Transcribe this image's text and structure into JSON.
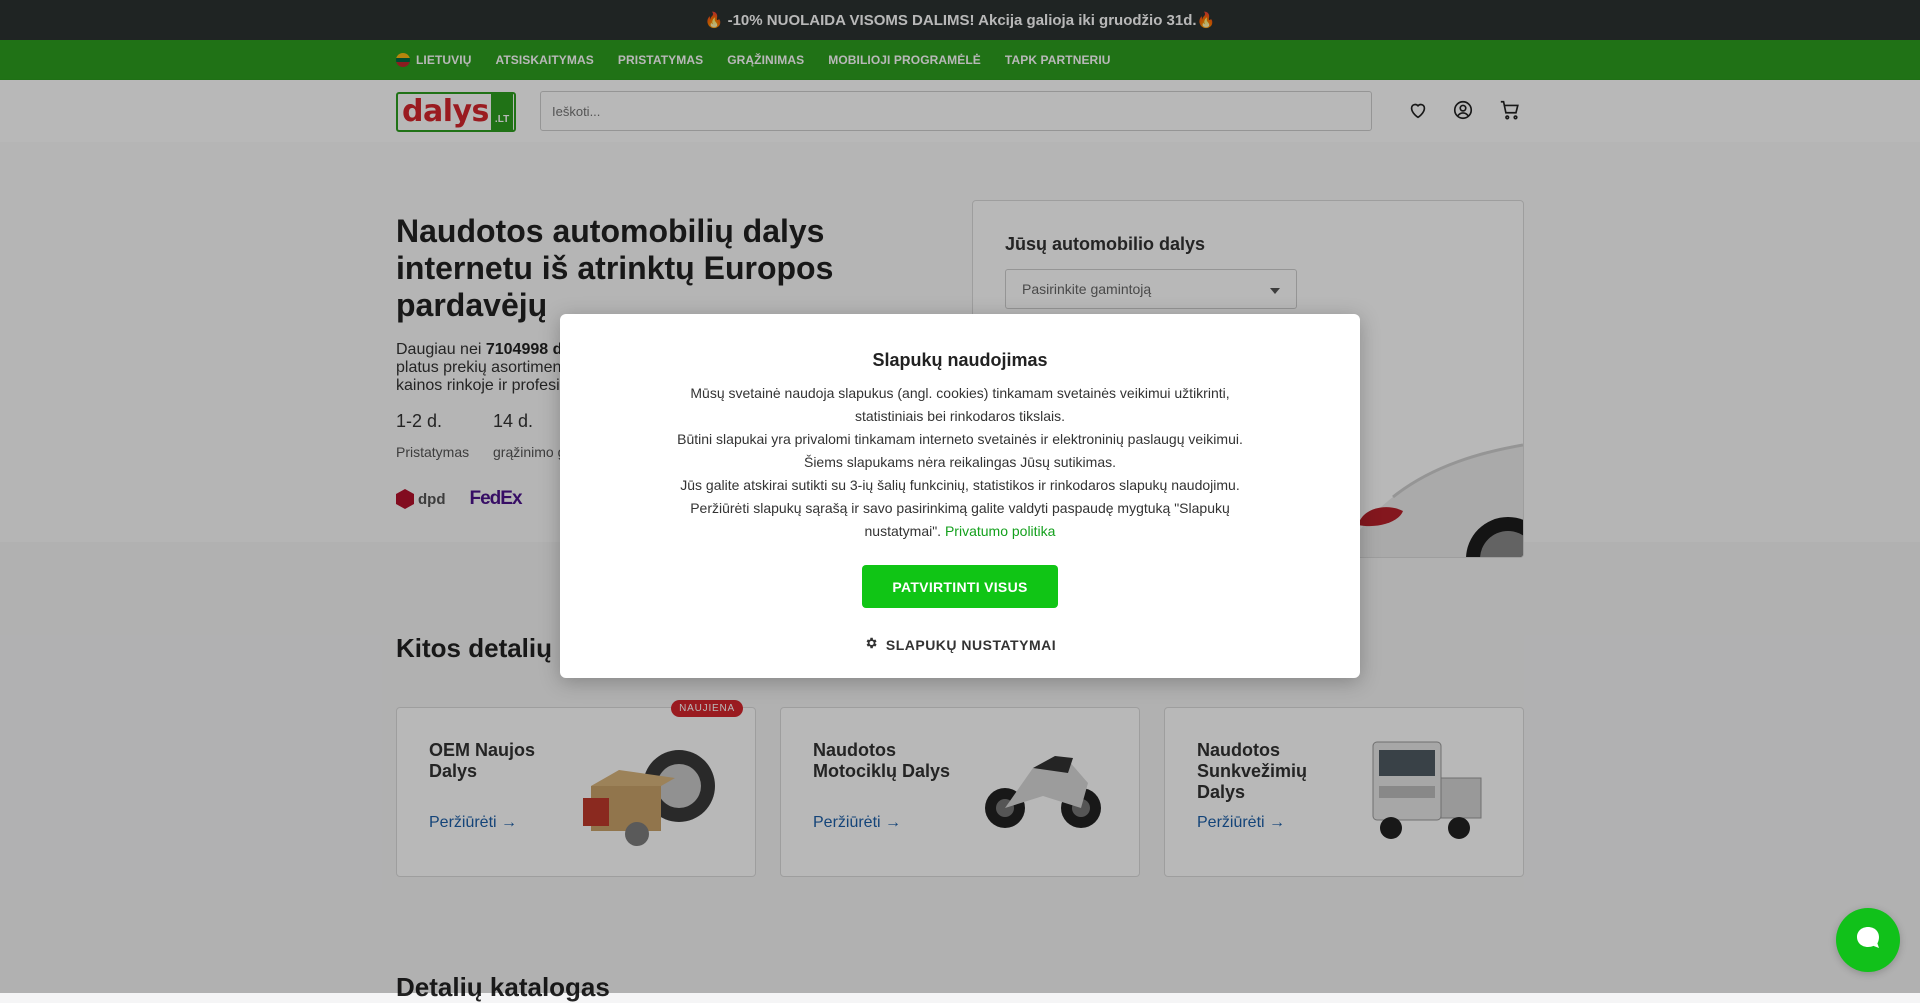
{
  "promo": {
    "text": "🔥 -10% NUOLAIDA VISOMS DALIMS! Akcija galioja iki gruodžio 31d.🔥"
  },
  "nav": {
    "language": "LIETUVIŲ",
    "items": [
      "ATSISKAITYMAS",
      "PRISTATYMAS",
      "GRĄŽINIMAS",
      "MOBILIOJI PROGRAMĖLĖ",
      "TAPK PARTNERIU"
    ]
  },
  "header": {
    "logo_text": "dalys",
    "logo_tld": ".LT",
    "search_placeholder": "Ieškoti..."
  },
  "hero": {
    "title": "Naudotos automobilių dalys internetu iš atrinktų Europos pardavėjų",
    "desc_prefix": "Daugiau nei ",
    "desc_bold": "7104998 d",
    "desc_line2": "platus prekių asortimen",
    "desc_line3": "kainos rinkoje ir profesi",
    "stats": [
      {
        "value": "1-2 d.",
        "label": "Pristatymas"
      },
      {
        "value": "14 d.",
        "label": "grąžinimo g"
      }
    ],
    "carriers": [
      "dpd",
      "FedEx"
    ]
  },
  "parts_panel": {
    "title": "Jūsų automobilio dalys",
    "maker_placeholder": "Pasirinkite gamintoją"
  },
  "categories": {
    "title": "Kitos detalių",
    "view_label": "Peržiūrėti",
    "badge": "NAUJIENA",
    "items": [
      {
        "name": "OEM Naujos Dalys"
      },
      {
        "name": "Naudotos Motociklų Dalys"
      },
      {
        "name": "Naudotos Sunkvežimių Dalys"
      }
    ]
  },
  "catalog": {
    "title": "Detalių katalogas"
  },
  "cookie": {
    "title": "Slapukų naudojimas",
    "p1": "Mūsų svetainė naudoja slapukus (angl. cookies) tinkamam svetainės veikimui užtikrinti, statistiniais bei rinkodaros tikslais.",
    "p2": "Būtini slapukai yra privalomi tinkamam interneto svetainės ir elektroninių paslaugų veikimui. Šiems slapukams nėra reikalingas Jūsų sutikimas.",
    "p3": "Jūs galite atskirai sutikti su 3-ių šalių funkcinių, statistikos ir rinkodaros slapukų naudojimu. Peržiūrėti slapukų sąrašą ir savo pasirinkimą galite valdyti paspaudę mygtuką \"Slapukų nustatymai\".",
    "privacy_link": "Privatumo politika",
    "accept_label": "PATVIRTINTI VISUS",
    "settings_label": "SLAPUKŲ NUSTATYMAI"
  },
  "icons": {
    "wishlist": "heart-icon",
    "account": "user-icon",
    "cart": "cart-icon",
    "settings": "gear-icon",
    "chat": "chat-icon"
  },
  "colors": {
    "nav_green": "#2d9e1f",
    "accept_green": "#10c515",
    "brand_red": "#d6262d",
    "link_blue": "#1d5fa8",
    "promo_bg": "#2b3331"
  }
}
